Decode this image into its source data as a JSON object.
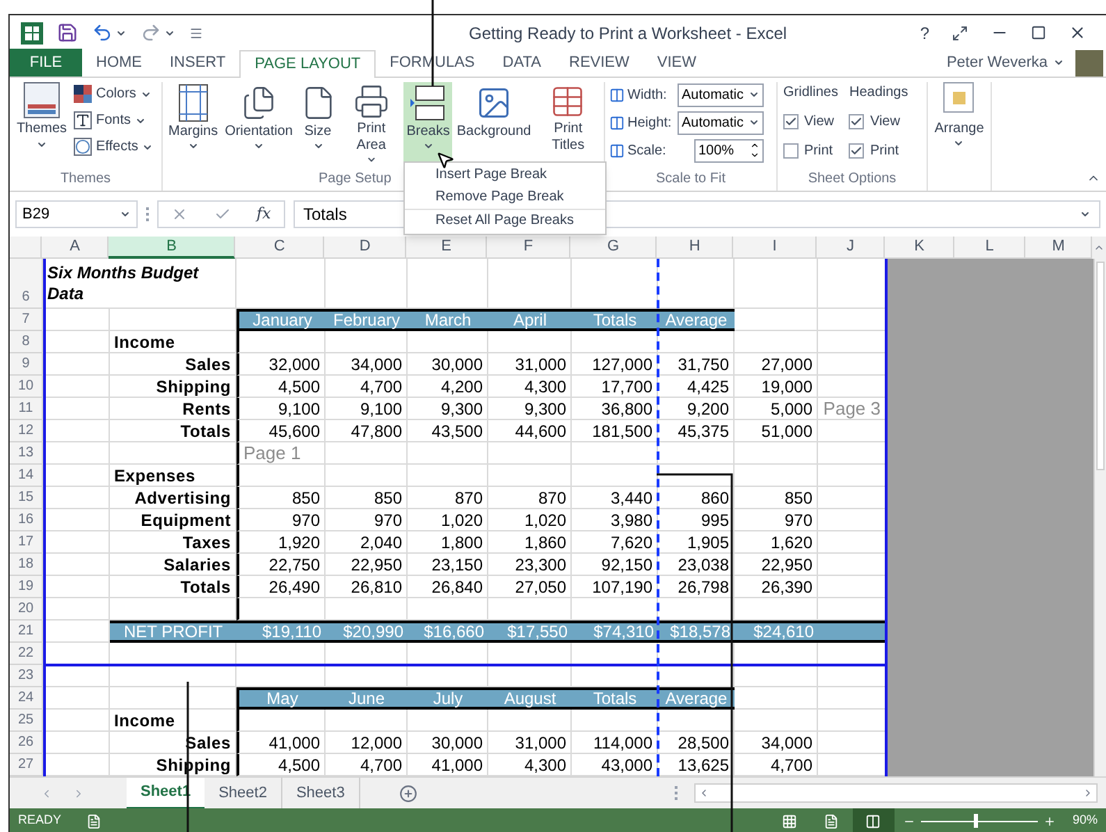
{
  "window": {
    "title": "Getting Ready to Print a Worksheet - Excel",
    "help": "?",
    "user": "Peter Weverka"
  },
  "ribbon_tabs": [
    {
      "label": "FILE",
      "kind": "file",
      "selected": false
    },
    {
      "label": "HOME",
      "kind": "tab",
      "selected": false
    },
    {
      "label": "INSERT",
      "kind": "tab",
      "selected": false
    },
    {
      "label": "PAGE LAYOUT",
      "kind": "tab",
      "selected": true
    },
    {
      "label": "FORMULAS",
      "kind": "tab",
      "selected": false
    },
    {
      "label": "DATA",
      "kind": "tab",
      "selected": false
    },
    {
      "label": "REVIEW",
      "kind": "tab",
      "selected": false
    },
    {
      "label": "VIEW",
      "kind": "tab",
      "selected": false
    }
  ],
  "themes_group": {
    "label": "Themes",
    "button": "Themes",
    "items": [
      "Colors",
      "Fonts",
      "Effects"
    ]
  },
  "page_setup_group": {
    "label": "Page Setup",
    "buttons": [
      {
        "label": "Margins",
        "dropdown": true,
        "selected": false
      },
      {
        "label": "Orientation",
        "dropdown": true,
        "selected": false
      },
      {
        "label": "Size",
        "dropdown": true,
        "selected": false
      },
      {
        "label": "Print Area",
        "dropdown": true,
        "selected": false
      },
      {
        "label": "Breaks",
        "dropdown": true,
        "selected": true
      },
      {
        "label": "Background",
        "dropdown": false,
        "selected": false
      },
      {
        "label": "Print Titles",
        "dropdown": false,
        "selected": false
      }
    ]
  },
  "scale_group": {
    "label": "Scale to Fit",
    "fields": [
      {
        "label": "Width:",
        "value": "Automatic",
        "kind": "dropdown"
      },
      {
        "label": "Height:",
        "value": "Automatic",
        "kind": "dropdown"
      },
      {
        "label": "Scale:",
        "value": "100%",
        "kind": "spinner"
      }
    ]
  },
  "sheet_options": {
    "label": "Sheet Options",
    "columns": [
      {
        "heading": "Gridlines",
        "options": [
          {
            "label": "View",
            "checked": true
          },
          {
            "label": "Print",
            "checked": false
          }
        ]
      },
      {
        "heading": "Headings",
        "options": [
          {
            "label": "View",
            "checked": true
          },
          {
            "label": "Print",
            "checked": true
          }
        ]
      }
    ]
  },
  "arrange_group": {
    "button": "Arrange"
  },
  "breaks_menu": {
    "items": [
      "Insert Page Break",
      "Remove Page Break",
      "Reset All Page Breaks"
    ]
  },
  "formula_bar": {
    "name_box": "B29",
    "function_label": "fx",
    "value": "Totals"
  },
  "columns": [
    {
      "label": "A",
      "selected": false
    },
    {
      "label": "B",
      "selected": true
    },
    {
      "label": "C",
      "selected": false
    },
    {
      "label": "D",
      "selected": false
    },
    {
      "label": "E",
      "selected": false
    },
    {
      "label": "F",
      "selected": false
    },
    {
      "label": "G",
      "selected": false
    },
    {
      "label": "H",
      "selected": false
    },
    {
      "label": "I",
      "selected": false
    },
    {
      "label": "J",
      "selected": false
    },
    {
      "label": "K",
      "selected": false
    },
    {
      "label": "L",
      "selected": false
    },
    {
      "label": "M",
      "selected": false
    }
  ],
  "rows": [
    {
      "number": "6",
      "kind": "title",
      "cells": [
        "Six Months Budget Data"
      ]
    },
    {
      "number": "7",
      "kind": "header",
      "cells": [
        null,
        null,
        "January",
        "February",
        "March",
        "April",
        "Totals",
        "Average"
      ]
    },
    {
      "number": "8",
      "kind": "section",
      "cells": [
        null,
        "Income"
      ]
    },
    {
      "number": "9",
      "kind": "data",
      "cells": [
        null,
        "Sales",
        "32,000",
        "34,000",
        "30,000",
        "31,000",
        "127,000",
        "31,750",
        "27,000"
      ]
    },
    {
      "number": "10",
      "kind": "data",
      "cells": [
        null,
        "Shipping",
        "4,500",
        "4,700",
        "4,200",
        "4,300",
        "17,700",
        "4,425",
        "19,000"
      ]
    },
    {
      "number": "11",
      "kind": "data",
      "cells": [
        null,
        "Rents",
        "9,100",
        "9,100",
        "9,300",
        "9,300",
        "36,800",
        "9,200",
        "5,000"
      ],
      "page_label": "Page 3"
    },
    {
      "number": "12",
      "kind": "data",
      "cells": [
        null,
        "Totals",
        "45,600",
        "47,800",
        "43,500",
        "44,600",
        "181,500",
        "45,375",
        "51,000"
      ]
    },
    {
      "number": "13",
      "kind": "blank",
      "cells": [
        null,
        null
      ],
      "page_label": "Page 1"
    },
    {
      "number": "14",
      "kind": "section",
      "cells": [
        null,
        "Expenses"
      ]
    },
    {
      "number": "15",
      "kind": "data",
      "cells": [
        null,
        "Advertising",
        "850",
        "850",
        "870",
        "870",
        "3,440",
        "860",
        "850"
      ]
    },
    {
      "number": "16",
      "kind": "data",
      "cells": [
        null,
        "Equipment",
        "970",
        "970",
        "1,020",
        "1,020",
        "3,980",
        "995",
        "970"
      ]
    },
    {
      "number": "17",
      "kind": "data",
      "cells": [
        null,
        "Taxes",
        "1,920",
        "2,040",
        "1,800",
        "1,860",
        "7,620",
        "1,905",
        "1,620"
      ]
    },
    {
      "number": "18",
      "kind": "data",
      "cells": [
        null,
        "Salaries",
        "22,750",
        "22,950",
        "23,150",
        "23,300",
        "92,150",
        "23,038",
        "22,950"
      ]
    },
    {
      "number": "19",
      "kind": "data",
      "cells": [
        null,
        "Totals",
        "26,490",
        "26,810",
        "26,840",
        "27,050",
        "107,190",
        "26,798",
        "26,390"
      ]
    },
    {
      "number": "20",
      "kind": "blank",
      "cells": []
    },
    {
      "number": "21",
      "kind": "profit",
      "cells": [
        null,
        "NET PROFIT",
        "$19,110",
        "$20,990",
        "$16,660",
        "$17,550",
        "$74,310",
        "$18,578",
        "$24,610"
      ]
    },
    {
      "number": "22",
      "kind": "gap",
      "cells": []
    },
    {
      "number": "23",
      "kind": "gap",
      "cells": []
    },
    {
      "number": "24",
      "kind": "header",
      "cells": [
        null,
        null,
        "May",
        "June",
        "July",
        "August",
        "Totals",
        "Average"
      ]
    },
    {
      "number": "25",
      "kind": "section",
      "cells": [
        null,
        "Income"
      ]
    },
    {
      "number": "26",
      "kind": "data",
      "cells": [
        null,
        "Sales",
        "41,000",
        "12,000",
        "30,000",
        "31,000",
        "114,000",
        "28,500",
        "34,000"
      ]
    },
    {
      "number": "27",
      "kind": "data",
      "cells": [
        null,
        "Shipping",
        "4,500",
        "4,700",
        "41,000",
        "4,300",
        "43,000",
        "13,625",
        "4,700"
      ]
    }
  ],
  "sheet_tabs": [
    {
      "label": "Sheet1",
      "selected": true
    },
    {
      "label": "Sheet2",
      "selected": false
    },
    {
      "label": "Sheet3",
      "selected": false
    }
  ],
  "status_bar": {
    "mode": "READY",
    "views": [
      {
        "selected": false
      },
      {
        "selected": false
      },
      {
        "selected": true
      }
    ],
    "zoom": {
      "level": 0.45,
      "reading": "90%"
    }
  }
}
